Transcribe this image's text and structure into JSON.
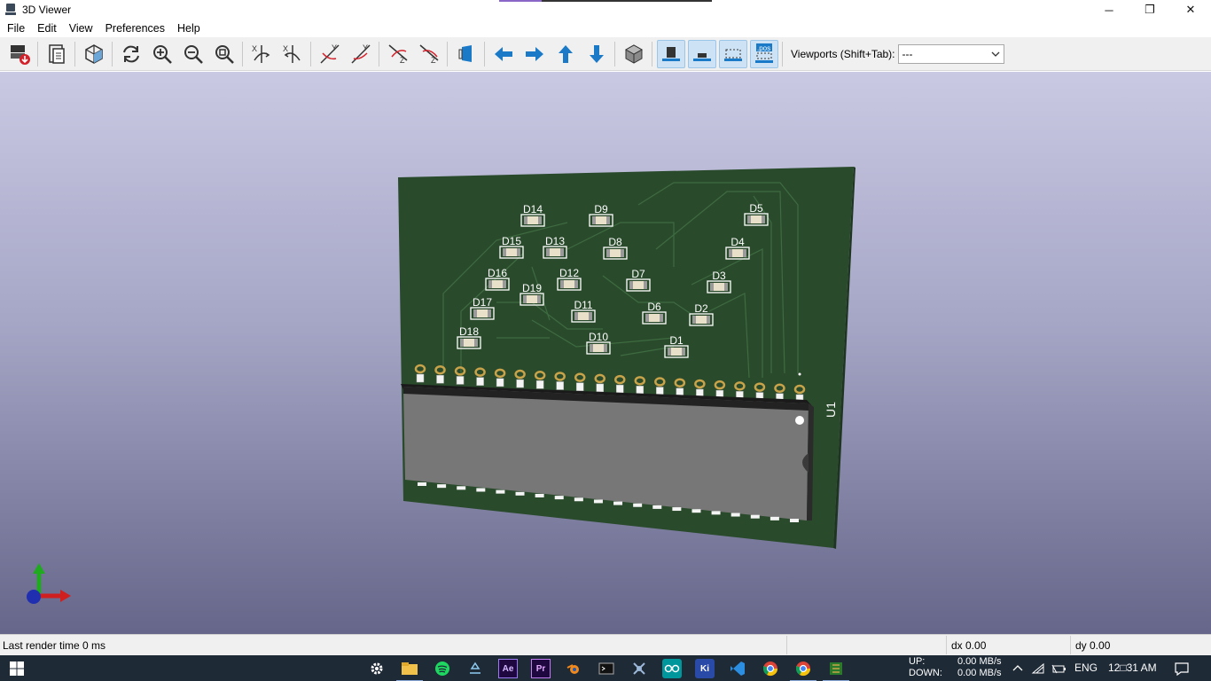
{
  "window": {
    "title": "3D Viewer",
    "minimize_glyph": "─",
    "restore_glyph": "❐",
    "close_glyph": "✕"
  },
  "menu": [
    "File",
    "Edit",
    "View",
    "Preferences",
    "Help"
  ],
  "toolbar": {
    "viewports_label": "Viewports (Shift+Tab):",
    "viewports_value": "---",
    "icons": [
      "export-image-icon",
      "copy-clipboard-icon",
      "raytracing-icon",
      "reload-icon",
      "zoom-in-icon",
      "zoom-out-icon",
      "zoom-fit-icon",
      "rotate-x-cw-icon",
      "rotate-x-ccw-icon",
      "rotate-y-cw-icon",
      "rotate-y-ccw-icon",
      "rotate-z-cw-icon",
      "rotate-z-ccw-icon",
      "flip-board-icon",
      "pan-left-icon",
      "pan-right-icon",
      "pan-up-icon",
      "pan-down-icon",
      "ortho-projection-icon",
      "show-tht-icon",
      "show-smd-icon",
      "show-virtual-icon",
      "show-not-in-posfile-icon"
    ],
    "pos_label": ".pos"
  },
  "board": {
    "designators": [
      {
        "ref": "D14"
      },
      {
        "ref": "D9"
      },
      {
        "ref": "D5"
      },
      {
        "ref": "D15"
      },
      {
        "ref": "D13"
      },
      {
        "ref": "D8"
      },
      {
        "ref": "D4"
      },
      {
        "ref": "D16"
      },
      {
        "ref": "D12"
      },
      {
        "ref": "D7"
      },
      {
        "ref": "D3"
      },
      {
        "ref": "D19"
      },
      {
        "ref": "D17"
      },
      {
        "ref": "D11"
      },
      {
        "ref": "D6"
      },
      {
        "ref": "D2"
      },
      {
        "ref": "D18"
      },
      {
        "ref": "D10"
      },
      {
        "ref": "D1"
      }
    ],
    "ic_ref": "U1",
    "colors": {
      "soldermask": "#2a4a2c",
      "silkscreen": "#ffffff",
      "pad": "#c8a34a",
      "ic_body": "#787878"
    }
  },
  "status": {
    "render_time": "Last render time 0 ms",
    "dx": "dx 0.00",
    "dy": "dy 0.00"
  },
  "taskbar": {
    "apps": [
      "settings-icon",
      "file-explorer-icon",
      "spotify-icon",
      "app-icon",
      "after-effects-icon",
      "premiere-icon",
      "blender-icon",
      "terminal-icon",
      "app2-icon",
      "arduino-icon",
      "kicad-icon",
      "vscode-icon",
      "chrome-icon",
      "chrome-2-icon",
      "pcbnew-icon"
    ],
    "ae_label": "Ae",
    "pr_label": "Pr",
    "ki_label": "Ki",
    "net_up_label": "UP:",
    "net_down_label": "DOWN:",
    "net_up_value": "0.00 MB/s",
    "net_down_value": "0.00 MB/s",
    "language": "ENG",
    "clock": "12□31 AM"
  }
}
